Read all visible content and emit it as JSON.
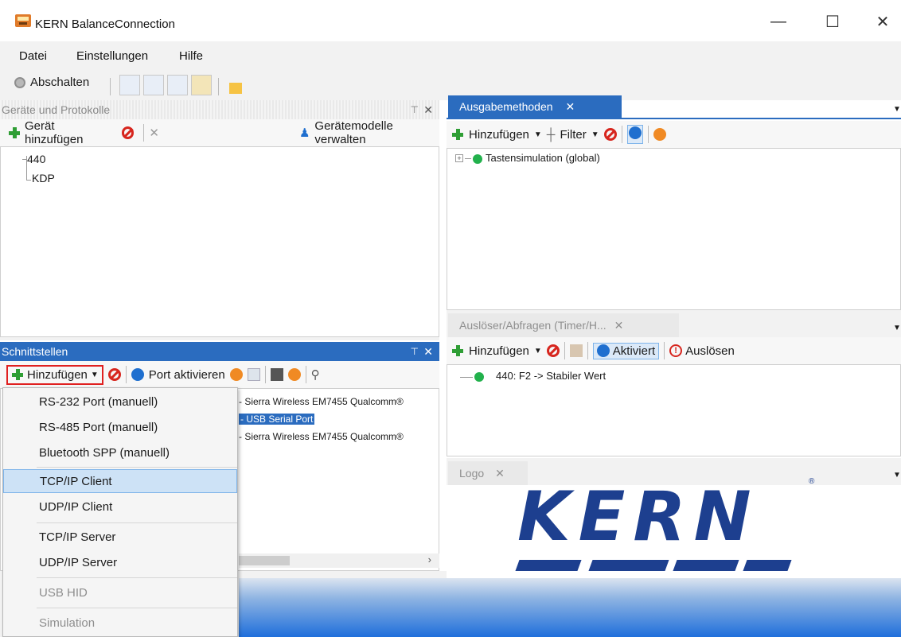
{
  "window": {
    "title": "KERN BalanceConnection",
    "minimize": "—",
    "maximize": "☐",
    "close": "✕"
  },
  "menu": [
    "Datei",
    "Einstellungen",
    "Hilfe"
  ],
  "toolbar": {
    "off_label": "Abschalten"
  },
  "devices_panel": {
    "title": "Geräte und Protokolle",
    "pin": "⊤",
    "close": "✕",
    "add_label": "Gerät hinzufügen",
    "manage_label": "Gerätemodelle verwalten",
    "items": [
      "440",
      "KDP"
    ]
  },
  "output_panel": {
    "tab": "Ausgabemethoden",
    "tab_close": "✕",
    "add_label": "Hinzufügen",
    "filter_label": "Filter",
    "tree_item": "Tastensimulation (global)"
  },
  "triggers_panel": {
    "tab": "Auslöser/Abfragen (Timer/H...",
    "tab_close": "✕",
    "add_label": "Hinzufügen",
    "activated_label": "Aktiviert",
    "trigger_label": "Auslösen",
    "item": "440: F2 -> Stabiler Wert"
  },
  "interfaces_panel": {
    "title": "Schnittstellen",
    "pin": "⊤",
    "close": "✕",
    "add_label": "Hinzufügen",
    "activate_label": "Port aktivieren",
    "ports": [
      "- Sierra Wireless EM7455 Qualcomm®",
      "- USB Serial Port",
      "- Sierra Wireless EM7455 Qualcomm®"
    ]
  },
  "dropdown": {
    "items": [
      {
        "label": "RS-232 Port (manuell)"
      },
      {
        "label": "RS-485 Port (manuell)"
      },
      {
        "label": "Bluetooth SPP (manuell)"
      },
      {
        "label": "TCP/IP Client"
      },
      {
        "label": "UDP/IP Client"
      },
      {
        "label": "TCP/IP Server"
      },
      {
        "label": "UDP/IP Server"
      },
      {
        "label": "USB HID"
      },
      {
        "label": "Simulation"
      }
    ]
  },
  "logo_panel": {
    "tab": "Logo",
    "tab_close": "✕",
    "logo_text": "KERN",
    "trademark": "®"
  },
  "colors": {
    "accent": "#2b6cbf",
    "logo": "#1d3f8f",
    "highlight_box": "#e02020"
  }
}
